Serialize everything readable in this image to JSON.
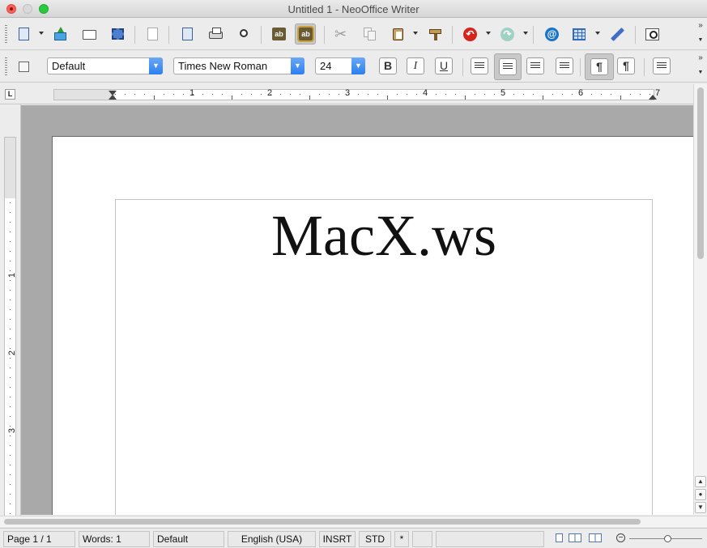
{
  "window": {
    "title": "Untitled 1 - NeoOffice Writer",
    "controls": {
      "close": "close-button",
      "minimize": "minimize-button",
      "zoom": "zoom-button"
    }
  },
  "toolbar_standard": {
    "items": [
      "new-document",
      "open",
      "save",
      "export",
      "export-pdf",
      "print",
      "page-preview",
      "spelling",
      "autospell",
      "cut",
      "copy",
      "paste",
      "clone-formatting",
      "undo",
      "redo",
      "hyperlink",
      "table",
      "draw-functions",
      "find-replace"
    ],
    "labels": {
      "spelling": "ab",
      "autospell": "ab",
      "undo": "↶",
      "redo": "↷",
      "hyperlink": "@",
      "overflow": "»"
    }
  },
  "toolbar_formatting": {
    "style_value": "Default",
    "font_value": "Times New Roman",
    "size_value": "24",
    "bold_label": "B",
    "italic_label": "I",
    "underline_label": "U",
    "paragraph_ltr": "¶",
    "paragraph_rtl": "¶",
    "overflow": "»"
  },
  "ruler": {
    "h_numbers": [
      "1",
      "2",
      "3",
      "4",
      "5",
      "6",
      "7"
    ],
    "v_numbers": [
      "1",
      "2",
      "3"
    ],
    "corner_label": "L"
  },
  "document": {
    "text": "MacX.ws"
  },
  "status_bar": {
    "page": "Page 1 / 1",
    "words": "Words: 1",
    "style": "Default",
    "language": "English (USA)",
    "insert_mode": "INSRT",
    "selection_mode": "STD",
    "modified": "*"
  },
  "colors": {
    "accent_blue": "#2c7ff0",
    "close": "#fc5f57",
    "zoom": "#2ac940",
    "canvas_gray": "#a9a9a9"
  }
}
